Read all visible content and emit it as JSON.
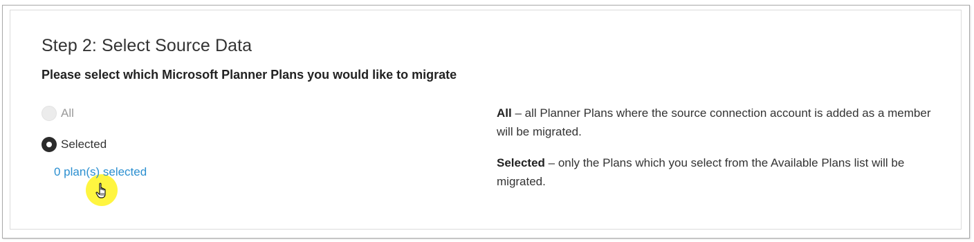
{
  "step": {
    "title": "Step 2: Select Source Data",
    "subtitle": "Please select which Microsoft Planner Plans you would like to migrate"
  },
  "options": [
    {
      "label": "All",
      "state": "disabled"
    },
    {
      "label": "Selected",
      "state": "checked"
    }
  ],
  "plans_link": "0 plan(s) selected",
  "descriptions": [
    {
      "term": "All",
      "text": " – all Planner Plans where the source connection account is added as a member will be migrated."
    },
    {
      "term": "Selected",
      "text": " – only the Plans which you select from the Available Plans list will be migrated."
    }
  ],
  "colors": {
    "link": "#2b8fd0",
    "radio_checked": "#2b2b2b",
    "cursor_highlight": "#fff200"
  },
  "icons": [
    "hand-pointer-icon"
  ]
}
